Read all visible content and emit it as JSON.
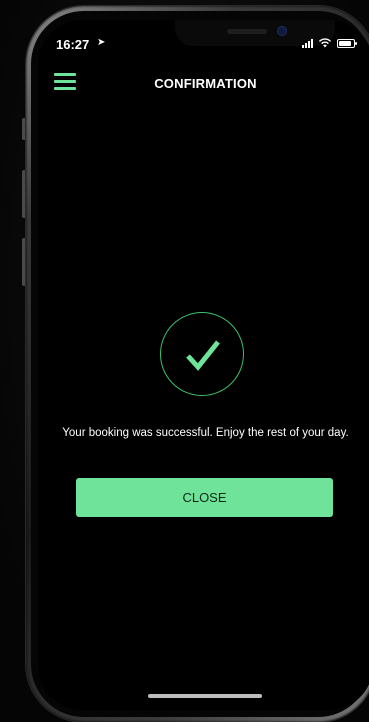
{
  "status_bar": {
    "time": "16:27",
    "location_icon": "location-arrow-icon",
    "right_icons": [
      "signal-icon",
      "wifi-icon",
      "battery-icon"
    ]
  },
  "header": {
    "menu_icon": "hamburger-menu-icon",
    "title": "CONFIRMATION"
  },
  "main": {
    "success_icon": "checkmark-icon",
    "message": "Your booking was successful. Enjoy the rest of your day.",
    "close_label": "CLOSE"
  },
  "colors": {
    "accent": "#6fe39a",
    "check_stroke": "#3fbf6d",
    "background": "#000000",
    "text": "#ffffff"
  }
}
